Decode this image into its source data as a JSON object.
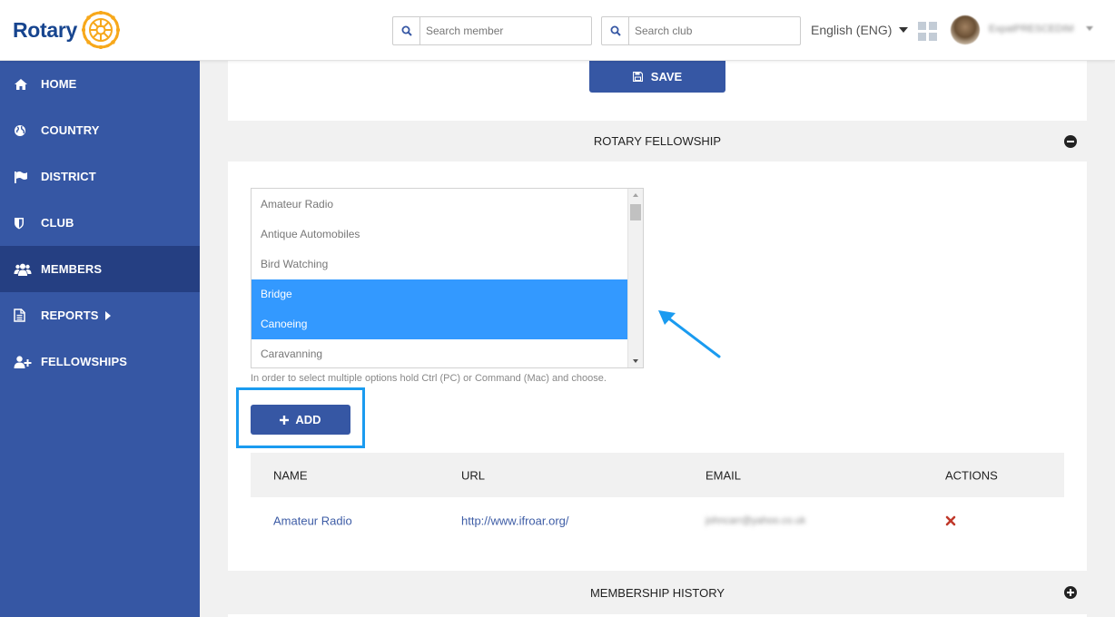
{
  "header": {
    "brand": "Rotary",
    "search_member_placeholder": "Search member",
    "search_club_placeholder": "Search club",
    "language": "English (ENG)",
    "user_name": "ExpatPRESCEDIM"
  },
  "sidebar": {
    "items": [
      {
        "label": "HOME",
        "icon": "home-icon"
      },
      {
        "label": "COUNTRY",
        "icon": "globe-icon"
      },
      {
        "label": "DISTRICT",
        "icon": "flag-icon"
      },
      {
        "label": "CLUB",
        "icon": "shield-icon"
      },
      {
        "label": "MEMBERS",
        "icon": "users-icon",
        "active": true
      },
      {
        "label": "REPORTS",
        "icon": "document-icon"
      },
      {
        "label": "FELLOWSHIPS",
        "icon": "user-plus-icon"
      }
    ]
  },
  "main": {
    "save_label": "SAVE",
    "fellowship_title": "ROTARY FELLOWSHIP",
    "fellowship_options": [
      {
        "label": "Amateur Radio",
        "selected": false
      },
      {
        "label": "Antique Automobiles",
        "selected": false
      },
      {
        "label": "Bird Watching",
        "selected": false
      },
      {
        "label": "Bridge",
        "selected": true
      },
      {
        "label": "Canoeing",
        "selected": true
      },
      {
        "label": "Caravanning",
        "selected": false
      }
    ],
    "hint": "In order to select multiple options hold Ctrl (PC) or Command (Mac) and choose.",
    "add_label": "ADD",
    "table": {
      "headers": [
        "NAME",
        "URL",
        "EMAIL",
        "ACTIONS"
      ],
      "rows": [
        {
          "name": "Amateur Radio",
          "url": "http://www.ifroar.org/",
          "email": "johncarr@yahoo.co.uk"
        }
      ]
    },
    "history_title": "MEMBERSHIP HISTORY"
  },
  "colors": {
    "sidebar": "#3657a4",
    "sidebar_active": "#253f82",
    "button": "#3657a4",
    "selected_option": "#3399ff",
    "annotation": "#1a9bf0",
    "delete": "#c0392b"
  }
}
